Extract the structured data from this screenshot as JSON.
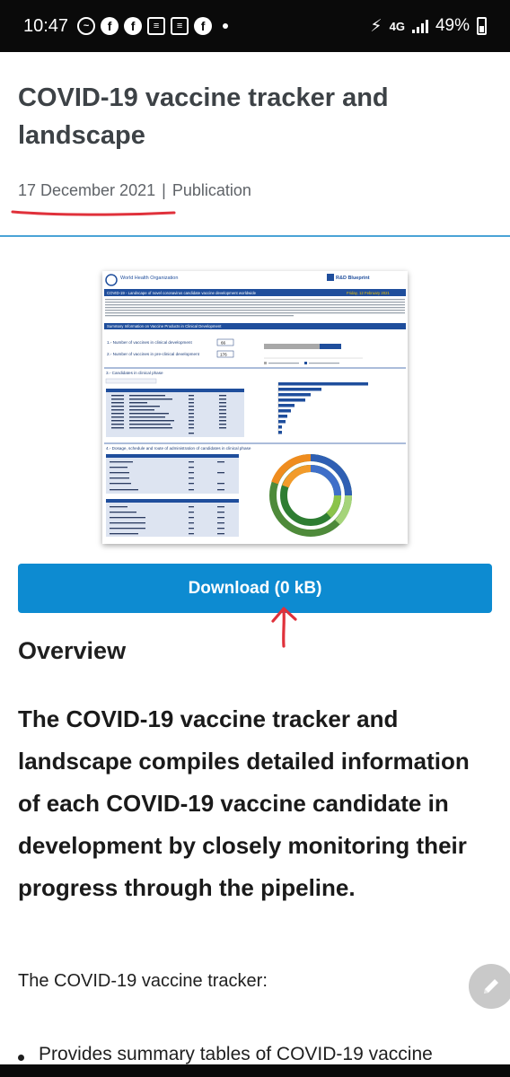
{
  "status_bar": {
    "time": "10:47",
    "network": "4G",
    "battery": "49%"
  },
  "article": {
    "title": "COVID-19 vaccine tracker and landscape",
    "date": "17 December 2021",
    "separator": "|",
    "type": "Publication"
  },
  "thumbnail": {
    "org": "World Health Organization",
    "brand": "R&D Blueprint",
    "banner": "COVID-19 - Landscape of novel coronavirus candidate vaccine development worldwide",
    "banner_date": "Friday, 12 February 2021",
    "summary_header": "Summary Information on Vaccine Products in Clinical Development",
    "row1_label": "1.- Number of vaccines in clinical development",
    "row1_value": "66",
    "row2_label": "2.- Number of vaccines in pre-clinical development",
    "row2_value": "176",
    "section3": "3.- Candidates in clinical phase",
    "section4": "4.- Dosage, schedule and route of administration of candidates in clinical phase"
  },
  "download": {
    "label": "Download (0 kB)"
  },
  "overview": {
    "heading": "Overview",
    "lead": "The COVID-19 vaccine tracker and landscape compiles detailed information of each COVID-19 vaccine candidate in development by closely monitoring their progress through the pipeline.",
    "paragraph": "The COVID-19 vaccine tracker:",
    "bullet": "Provides summary tables of COVID-19 vaccine"
  },
  "icons": [
    "messenger-icon",
    "facebook-icon",
    "news-icon",
    "wifi-calling-icon",
    "signal-icon",
    "battery-icon",
    "pencil-icon"
  ],
  "colors": {
    "accent": "#0d8bd1",
    "divider": "#4aa3d6",
    "annotation": "#e0313b",
    "who_blue": "#1f4e9c"
  }
}
